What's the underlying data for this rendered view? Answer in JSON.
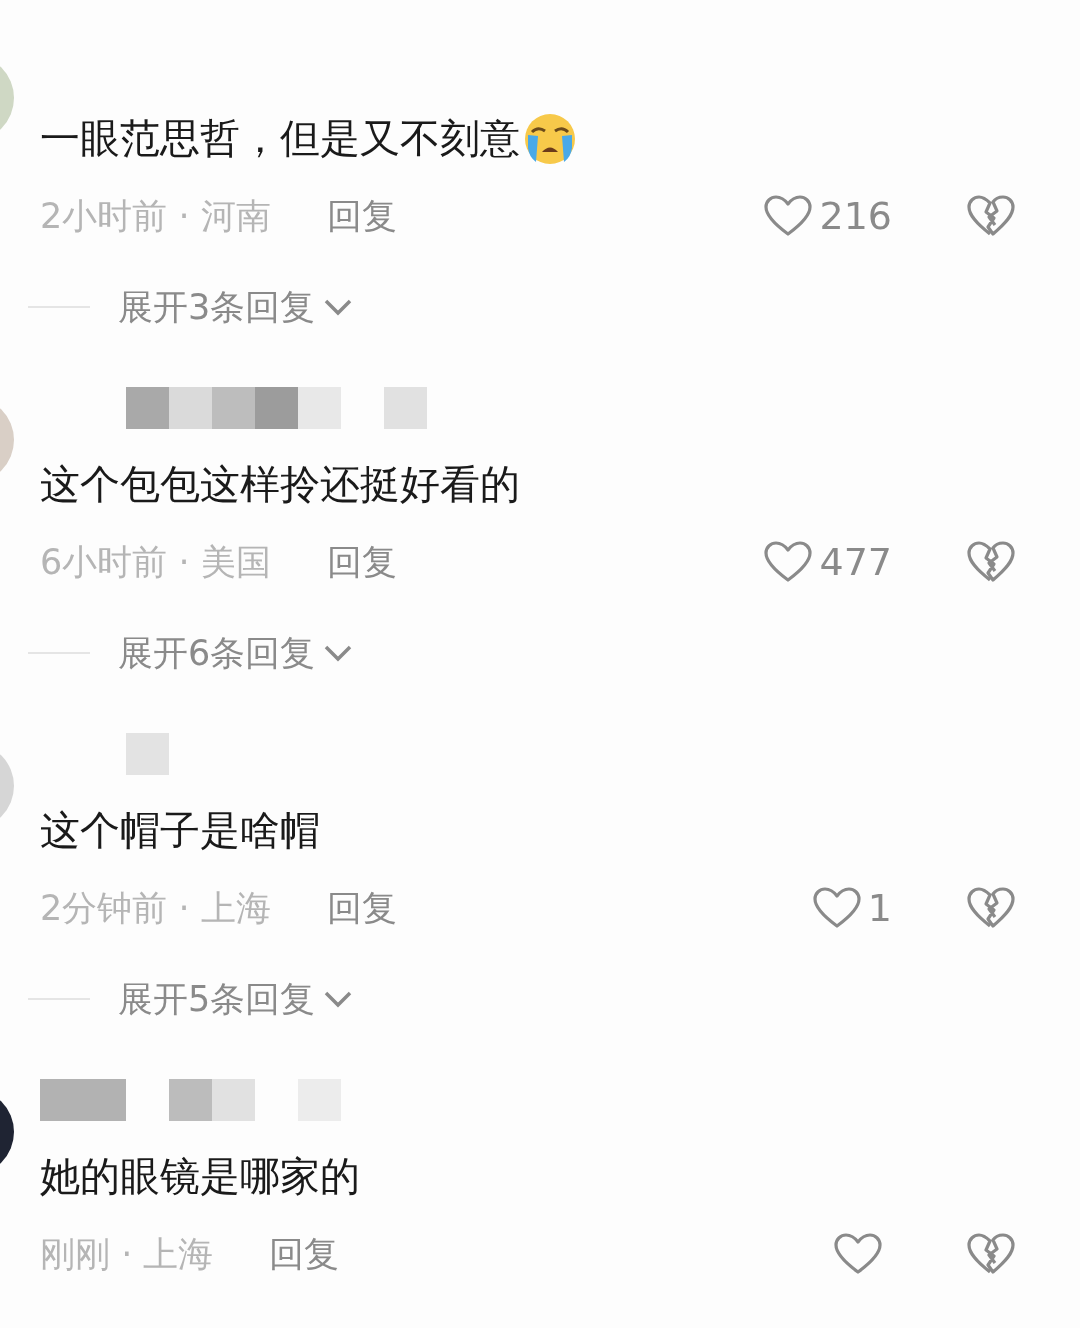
{
  "comments": [
    {
      "name_hidden": false,
      "text": "一眼范思哲，但是又不刻意",
      "emoji": true,
      "meta": "2小时前 · 河南",
      "reply": "回复",
      "likes": "216",
      "expand": "展开3条回复"
    },
    {
      "name_hidden": true,
      "text": "这个包包这样拎还挺好看的",
      "emoji": false,
      "meta": "6小时前 · 美国",
      "reply": "回复",
      "likes": "477",
      "expand": "展开6条回复"
    },
    {
      "name_hidden": true,
      "text": "这个帽子是啥帽",
      "emoji": false,
      "meta": "2分钟前 · 上海",
      "reply": "回复",
      "likes": "1",
      "expand": "展开5条回复"
    },
    {
      "name_hidden": true,
      "text": "她的眼镜是哪家的",
      "emoji": false,
      "meta": "刚刚 · 上海",
      "reply": "回复"
    }
  ]
}
